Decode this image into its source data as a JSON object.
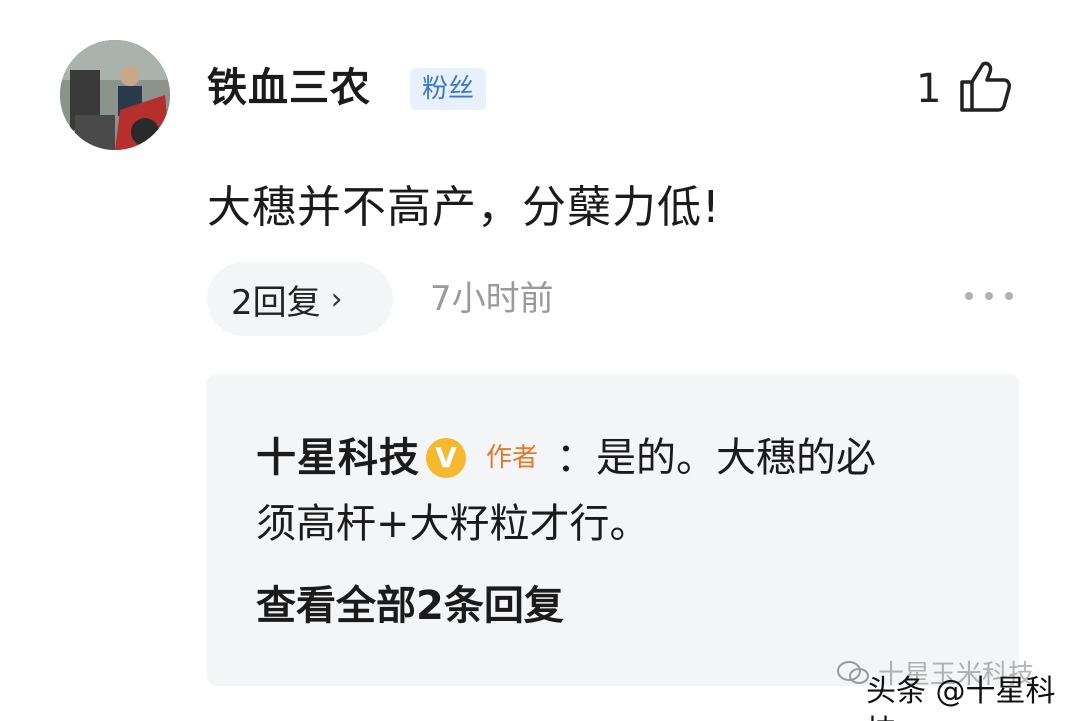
{
  "comment": {
    "username": "铁血三农",
    "badge": "粉丝",
    "like_count": "1",
    "text": "大穗并不高产，分蘖力低!",
    "replies_label": "2回复",
    "reply_chevron": "›",
    "time": "7小时前"
  },
  "reply": {
    "author": "十星科技",
    "verified_mark": "V",
    "author_tag": "作者",
    "text_line1": "：是的。大穗的必",
    "text_line2": "须高杆+大籽粒才行。",
    "view_all": "查看全部2条回复"
  },
  "watermark": {
    "top": "十星玉米科技",
    "bottom": "头条 @十星科技"
  },
  "icons": {
    "like": "thumbs-up-icon",
    "more": "more-dots-icon",
    "verified": "verified-v-icon",
    "wechat": "wechat-icon"
  },
  "colors": {
    "badge_bg": "#e8f1fb",
    "badge_text": "#3d78c8",
    "author_tag": "#e07b2e",
    "verified": "#f5b82e",
    "muted_text": "#9a9a9a",
    "panel_bg": "#f4f5f6"
  }
}
